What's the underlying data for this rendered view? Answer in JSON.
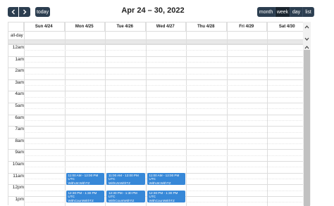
{
  "toolbar": {
    "prev_icon": "chevron-left-icon",
    "next_icon": "chevron-right-icon",
    "today_label": "today",
    "title": "Apr 24 – 30, 2022",
    "views": [
      {
        "label": "month",
        "active": false
      },
      {
        "label": "week",
        "active": true
      },
      {
        "label": "day",
        "active": false
      },
      {
        "label": "list",
        "active": false
      }
    ]
  },
  "calendar": {
    "allday_label": "all-day",
    "days": [
      "Sun 4/24",
      "Mon 4/25",
      "Tue 4/26",
      "Wed 4/27",
      "Thu 4/28",
      "Fri 4/29",
      "Sat 4/30"
    ],
    "times": [
      "12am",
      "1am",
      "2am",
      "3am",
      "4am",
      "5am",
      "6am",
      "7am",
      "8am",
      "9am",
      "10am",
      "11am",
      "12pm",
      "1pm"
    ],
    "events": [
      {
        "day": 1,
        "time": "11:00 AM - 12:00 PM UTC",
        "title": "WithUtcWithTZ"
      },
      {
        "day": 2,
        "time": "11:00 AM - 12:00 PM UTC",
        "title": "WithUtcWithTZ"
      },
      {
        "day": 3,
        "time": "11:00 AM - 12:00 PM UTC",
        "title": "WithUtcWithTZ"
      },
      {
        "day": 1,
        "time": "12:30 PM - 1:30 PM UTC",
        "title": "WithCountWithTZ"
      },
      {
        "day": 2,
        "time": "12:30 PM - 1:30 PM UTC",
        "title": "WithCountWithTZ"
      },
      {
        "day": 3,
        "time": "12:30 PM - 1:30 PM UTC",
        "title": "WithCountWithTZ"
      }
    ],
    "event_color": "#3788d8",
    "toolbar_color": "#2c3e50"
  }
}
